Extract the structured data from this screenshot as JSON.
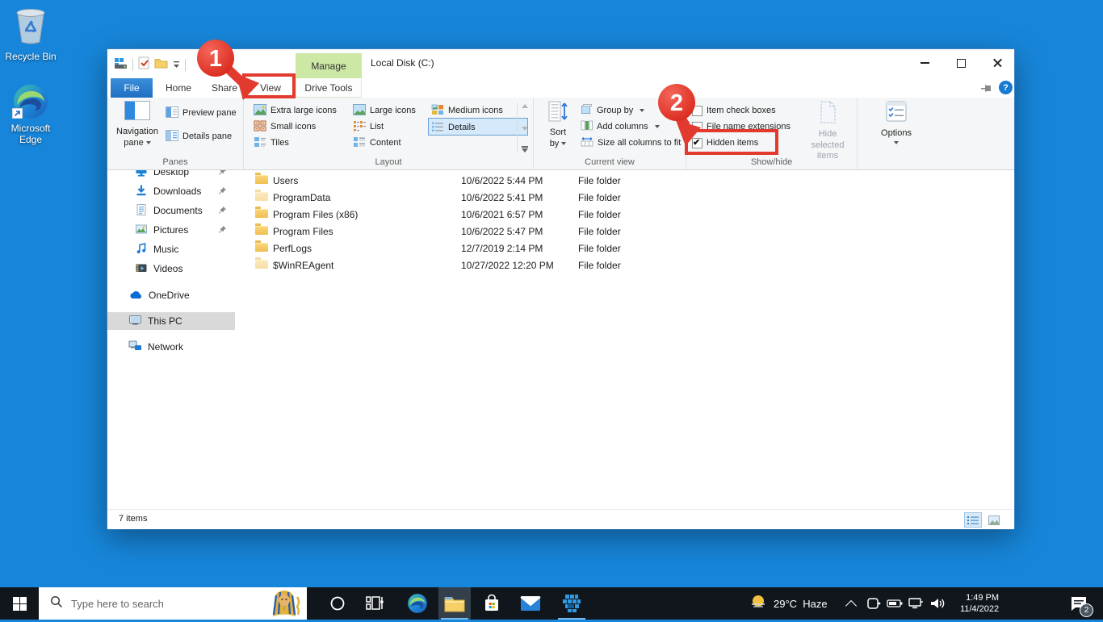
{
  "desktop": {
    "recycle_bin_label": "Recycle Bin",
    "edge_label": "Microsoft Edge"
  },
  "window": {
    "title": "Local Disk (C:)",
    "manage_label": "Manage",
    "help_label": "?",
    "tabs": {
      "file": "File",
      "home": "Home",
      "share": "Share",
      "view": "View",
      "drive_tools": "Drive Tools"
    },
    "ribbon": {
      "panes": {
        "label": "Panes",
        "navigation_line1": "Navigation",
        "navigation_line2": "pane",
        "preview": "Preview pane",
        "details_pane": "Details pane"
      },
      "layout": {
        "label": "Layout",
        "extra_large": "Extra large icons",
        "small": "Small icons",
        "tiles": "Tiles",
        "large": "Large icons",
        "list": "List",
        "content": "Content",
        "medium": "Medium icons",
        "details": "Details",
        "selected": "Details"
      },
      "current_view": {
        "label": "Current view",
        "sort_line1": "Sort",
        "sort_line2": "by",
        "group_by": "Group by",
        "add_columns": "Add columns",
        "size_columns": "Size all columns to fit"
      },
      "show_hide": {
        "label": "Show/hide",
        "item_check_boxes": "Item check boxes",
        "file_name_extensions": "File name extensions",
        "hidden_items": "Hidden items",
        "hidden_items_checked": true,
        "hide_selected_line1": "Hide selected",
        "hide_selected_line2": "items"
      },
      "options_label": "Options"
    },
    "sidebar": {
      "items": [
        {
          "label": "Desktop",
          "pinned": true
        },
        {
          "label": "Downloads",
          "pinned": true
        },
        {
          "label": "Documents",
          "pinned": true
        },
        {
          "label": "Pictures",
          "pinned": true
        },
        {
          "label": "Music",
          "pinned": false
        },
        {
          "label": "Videos",
          "pinned": false
        }
      ],
      "onedrive": "OneDrive",
      "this_pc": "This PC",
      "network": "Network",
      "selected": "This PC"
    },
    "files": {
      "rows": [
        {
          "name": "Users",
          "date": "10/6/2022 5:44 PM",
          "type": "File folder",
          "hidden": false
        },
        {
          "name": "ProgramData",
          "date": "10/6/2022 5:41 PM",
          "type": "File folder",
          "hidden": true
        },
        {
          "name": "Program Files (x86)",
          "date": "10/6/2021 6:57 PM",
          "type": "File folder",
          "hidden": false
        },
        {
          "name": "Program Files",
          "date": "10/6/2022 5:47 PM",
          "type": "File folder",
          "hidden": false
        },
        {
          "name": "PerfLogs",
          "date": "12/7/2019 2:14 PM",
          "type": "File folder",
          "hidden": false
        },
        {
          "name": "$WinREAgent",
          "date": "10/27/2022 12:20 PM",
          "type": "File folder",
          "hidden": true
        }
      ]
    },
    "status_bar": {
      "items_count": "7 items"
    }
  },
  "annotations": {
    "step1": "1",
    "step2": "2",
    "accent_color": "#e23a2e"
  },
  "taskbar": {
    "search_placeholder": "Type here to search",
    "tray": {
      "temperature": "29°C",
      "condition": "Haze",
      "time": "1:49 PM",
      "date": "11/4/2022",
      "notification_count": "2"
    }
  }
}
